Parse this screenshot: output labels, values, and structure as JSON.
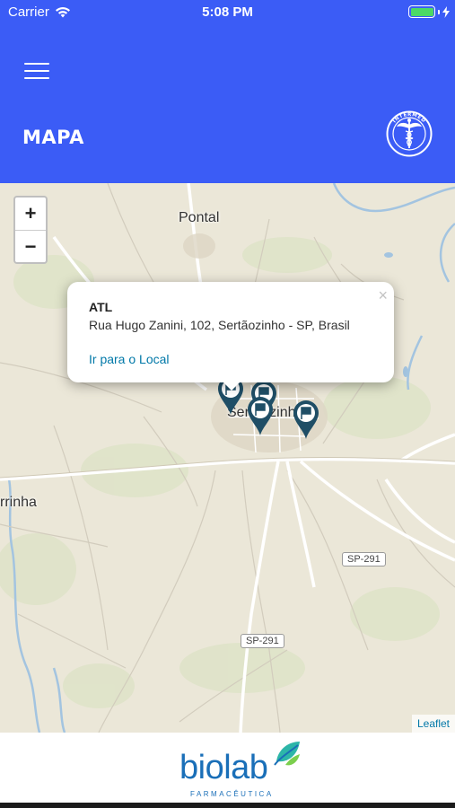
{
  "status_bar": {
    "carrier": "Carrier",
    "time": "5:08 PM"
  },
  "header": {
    "title": "MAPA",
    "background_color": "#3b5cf6",
    "menu_icon": "hamburger-menu-icon",
    "emblem_icon": "medical-caduceus-emblem-icon",
    "emblem_text": "INTERMED"
  },
  "map": {
    "zoom_in_label": "+",
    "zoom_out_label": "−",
    "places": [
      "Pontal",
      "Sertãozinho",
      "rrinha"
    ],
    "road_shields": [
      "SP-291",
      "SP-291"
    ],
    "popup": {
      "title": "ATL",
      "address": "Rua Hugo Zanini, 102, Sertãozinho - SP, Brasil",
      "link": "Ir para o Local",
      "close": "×"
    },
    "marker_icon": "map-pin-flag-icon",
    "marker_color": "#1f4e66",
    "attribution": "Leaflet"
  },
  "footer": {
    "logo_text": "biolab",
    "logo_subtitle": "FARMACÊUTICA",
    "logo_color": "#1a6fb8"
  }
}
